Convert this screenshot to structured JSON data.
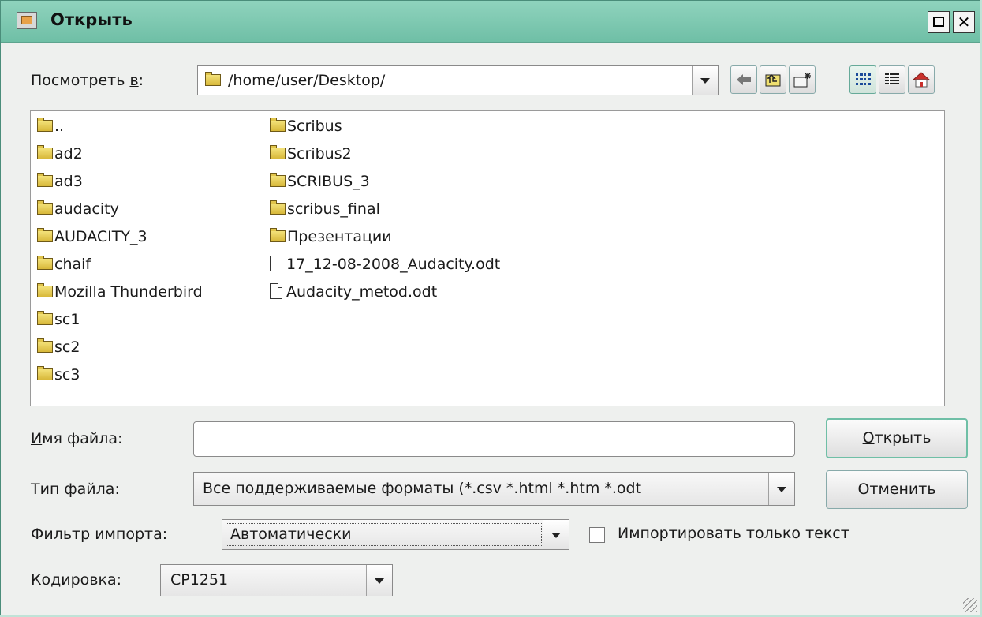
{
  "window": {
    "title": "Открыть"
  },
  "lookin": {
    "label_prefix": "Посмотреть ",
    "label_accel": "в",
    "label_suffix": ":",
    "path": "/home/user/Desktop/"
  },
  "files": {
    "column1": [
      "..",
      "ad2",
      "ad3",
      "audacity",
      "AUDACITY_3",
      "chaif",
      "Mozilla Thunderbird",
      "sc1",
      "sc2",
      "sc3"
    ],
    "column2_folders": [
      "Scribus",
      "Scribus2",
      "SCRIBUS_3",
      "scribus_final",
      "Презентации"
    ],
    "column2_files": [
      "17_12-08-2008_Audacity.odt",
      "Audacity_metod.odt"
    ]
  },
  "filename": {
    "label_accel": "И",
    "label_rest": "мя файла:",
    "value": ""
  },
  "filetype": {
    "label_accel": "Т",
    "label_rest": "ип файла:",
    "value": "Все поддерживаемые форматы (*.csv *.html *.htm *.odt"
  },
  "import_filter": {
    "label": "Фильтр импорта:",
    "value": "Автоматически"
  },
  "text_only": {
    "label": "Импортировать только текст",
    "checked": false
  },
  "encoding": {
    "label": "Кодировка:",
    "value": "CP1251"
  },
  "buttons": {
    "open_accel": "О",
    "open_rest": "ткрыть",
    "cancel": "Отменить"
  }
}
